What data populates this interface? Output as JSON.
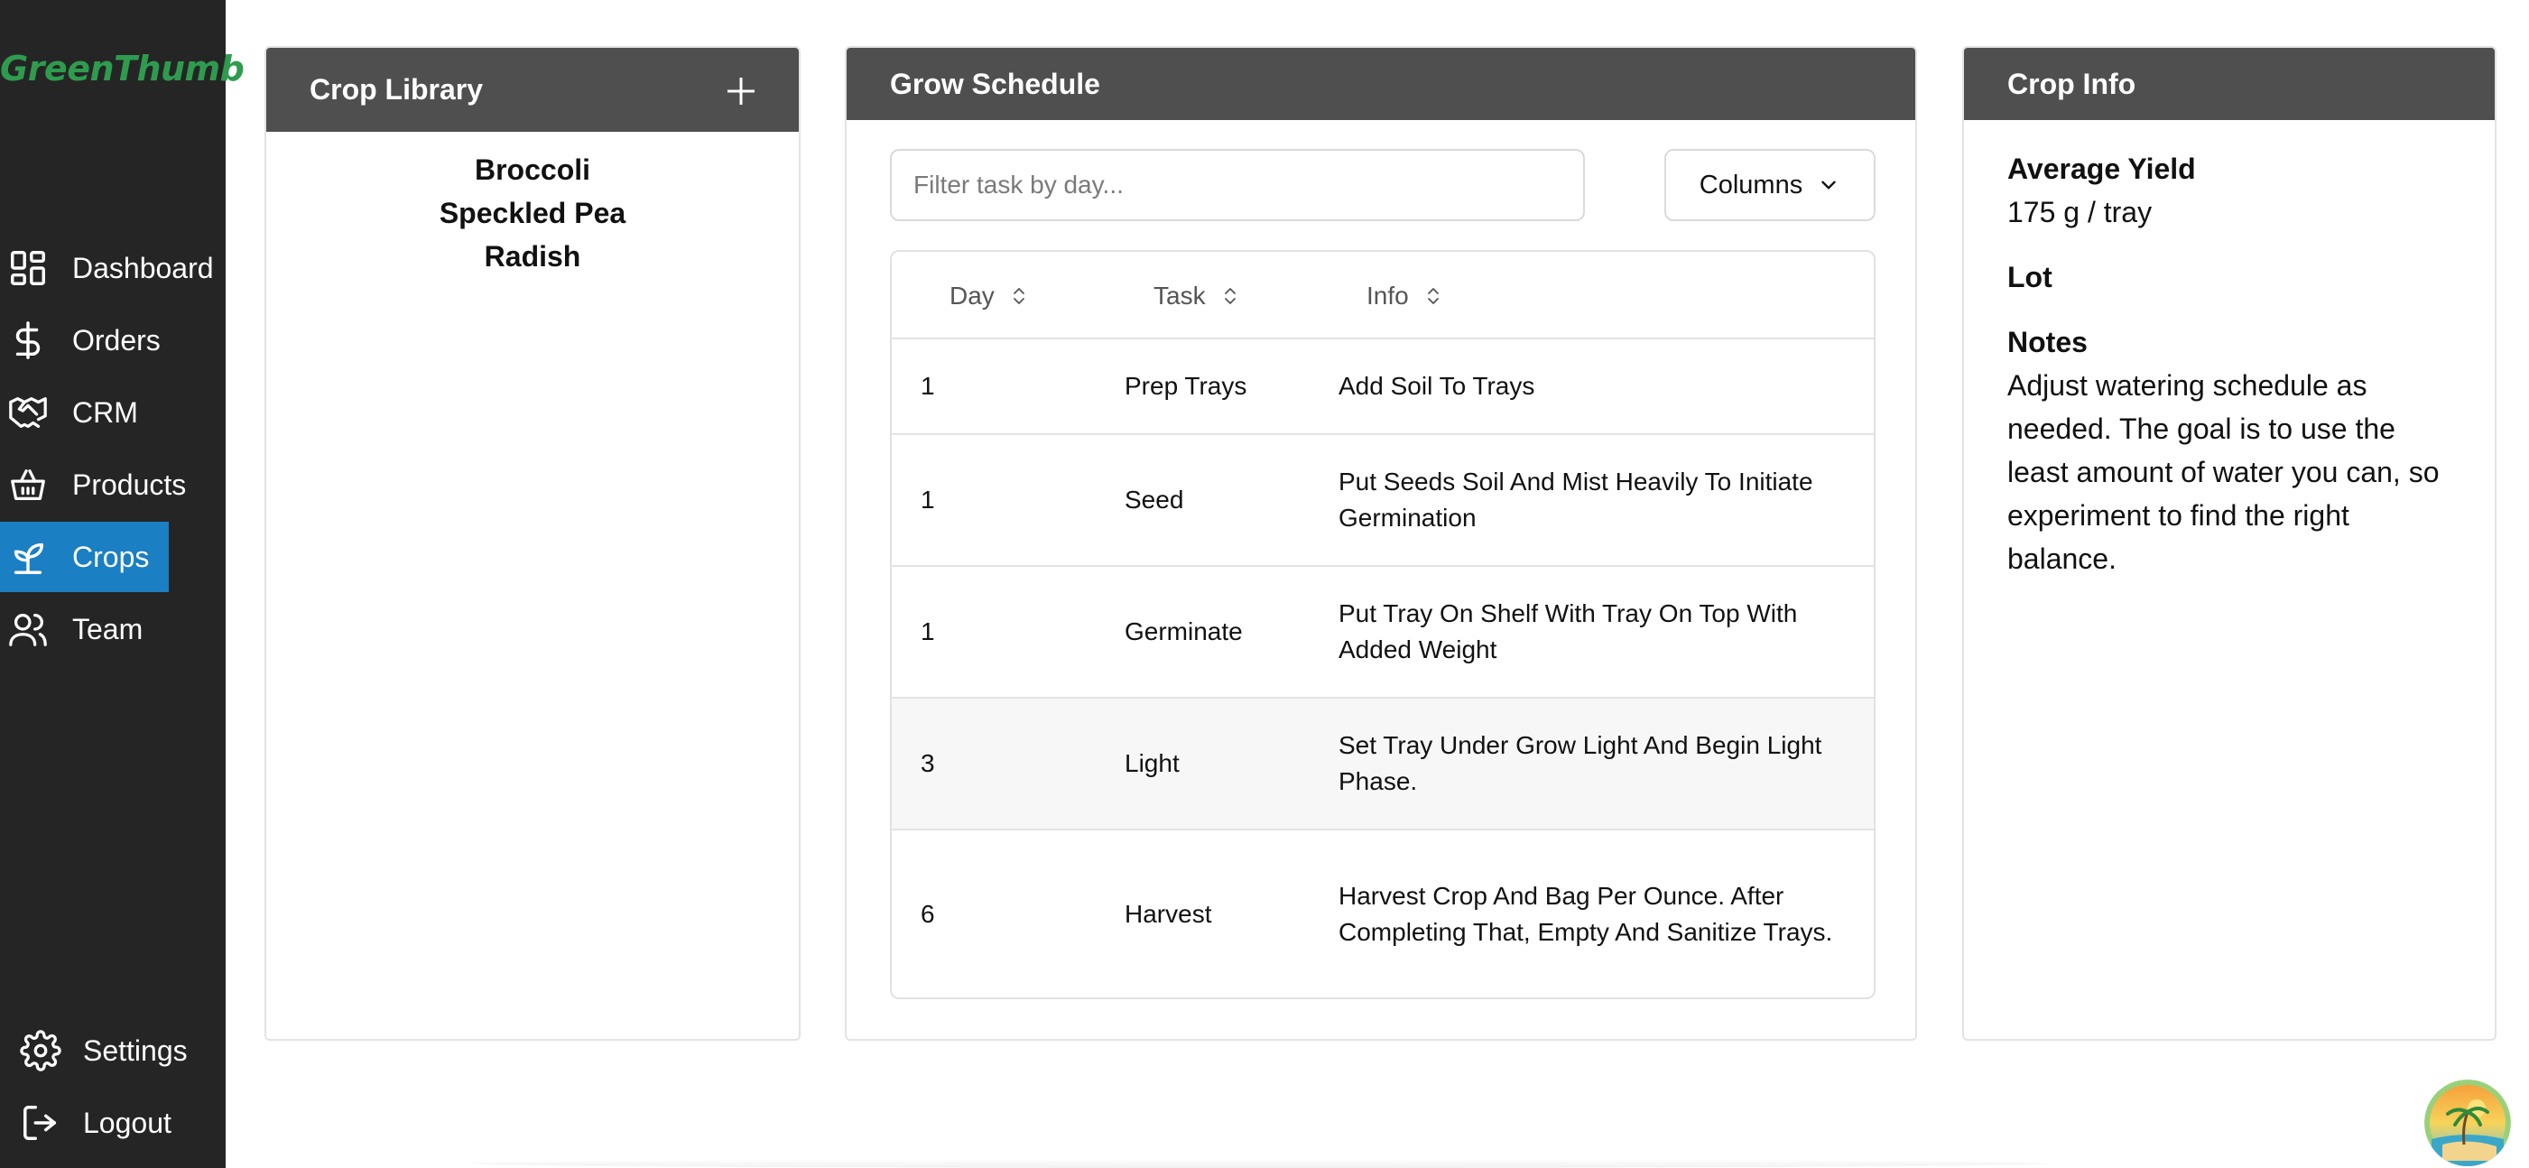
{
  "app": {
    "logo": "GreenThumb"
  },
  "sidebar": {
    "items": [
      {
        "label": "Dashboard",
        "icon": "dashboard-icon"
      },
      {
        "label": "Orders",
        "icon": "dollar-icon"
      },
      {
        "label": "CRM",
        "icon": "handshake-icon"
      },
      {
        "label": "Products",
        "icon": "basket-icon"
      },
      {
        "label": "Crops",
        "icon": "sprout-icon",
        "active": true
      },
      {
        "label": "Team",
        "icon": "users-icon"
      }
    ],
    "bottom": [
      {
        "label": "Settings",
        "icon": "gear-icon"
      },
      {
        "label": "Logout",
        "icon": "logout-icon"
      }
    ],
    "active_color": "#1a7fc3"
  },
  "library": {
    "title": "Crop Library",
    "crops": [
      "Broccoli",
      "Speckled Pea",
      "Radish"
    ]
  },
  "schedule": {
    "title": "Grow Schedule",
    "filter_placeholder": "Filter task by day...",
    "columns_label": "Columns",
    "headers": [
      "Day",
      "Task",
      "Info"
    ],
    "rows": [
      {
        "day": "1",
        "task": "Prep Trays",
        "info": "Add Soil To Trays"
      },
      {
        "day": "1",
        "task": "Seed",
        "info": "Put Seeds Soil And Mist Heavily To Initiate Germination"
      },
      {
        "day": "1",
        "task": "Germinate",
        "info": "Put Tray On Shelf With Tray On Top With Added Weight"
      },
      {
        "day": "3",
        "task": "Light",
        "info": "Set Tray Under Grow Light And Begin Light Phase."
      },
      {
        "day": "6",
        "task": "Harvest",
        "info": "Harvest Crop And Bag Per Ounce. After Completing That, Empty And Sanitize Trays."
      }
    ]
  },
  "info": {
    "title": "Crop Info",
    "yield_label": "Average Yield",
    "yield_value": "175 g / tray",
    "lot_label": "Lot",
    "notes_label": "Notes",
    "notes_value": "Adjust watering schedule as needed. The goal is to use the least amount of water you can, so experiment to find the right balance."
  }
}
